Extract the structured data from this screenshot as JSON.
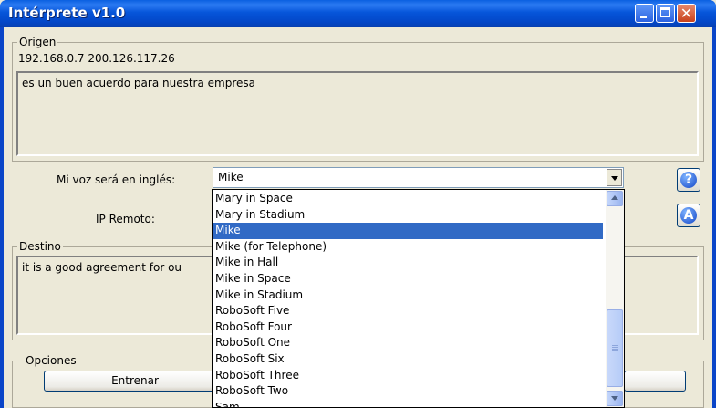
{
  "window": {
    "title": "Intérprete v1.0",
    "close_glyph": "✕"
  },
  "origen": {
    "legend": "Origen",
    "addresses": "192.168.0.7  200.126.117.26",
    "text": "es un buen acuerdo para nuestra empresa"
  },
  "voice": {
    "label": "Mi voz será en inglés:",
    "selected": "Mike",
    "options": [
      "Mary in Space",
      "Mary in Stadium",
      "Mike",
      "Mike (for Telephone)",
      "Mike in Hall",
      "Mike in Space",
      "Mike in Stadium",
      "RoboSoft Five",
      "RoboSoft Four",
      "RoboSoft One",
      "RoboSoft Six",
      "RoboSoft Three",
      "RoboSoft Two",
      "Sam"
    ],
    "selected_index": 2
  },
  "ip": {
    "label": "IP Remoto:"
  },
  "help_button": {
    "glyph": "?"
  },
  "about_button": {
    "glyph": "A"
  },
  "destino": {
    "legend": "Destino",
    "text": "it is a good agreement for ou"
  },
  "opciones": {
    "legend": "Opciones",
    "train_label": "Entrenar"
  },
  "colors": {
    "titlebar": "#0655DA",
    "selection": "#316AC5",
    "window_bg": "#ECE9D8"
  }
}
